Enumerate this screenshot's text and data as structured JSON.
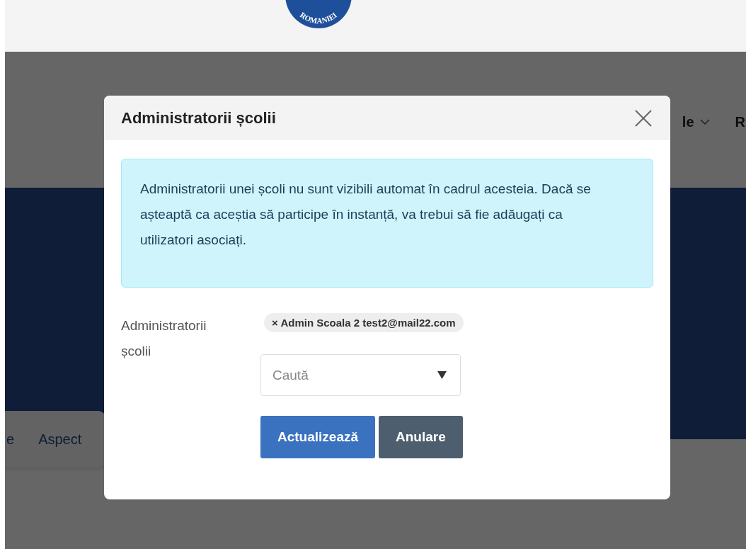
{
  "header": {
    "logo_text": "ROMANIEI"
  },
  "background": {
    "nav_items": [
      {
        "label": "le",
        "has_caret": true
      },
      {
        "label": "R",
        "has_caret": false
      }
    ],
    "tabs": [
      "e",
      "Aspect"
    ]
  },
  "modal": {
    "title": "Administratorii școlii",
    "alert": "Administratorii unei școli nu sunt vizibili automat în cadrul acesteia. Dacă se așteaptă ca aceștia să participe în instanță, va trebui să fie adăugați ca utilizatori asociați.",
    "field": {
      "label": "Administratorii școlii",
      "tags": [
        {
          "remove": "×",
          "label": "Admin Scoala 2 test2@mail22.com"
        }
      ],
      "placeholder": "Caută"
    },
    "buttons": [
      {
        "label": "Actualizează",
        "kind": "primary"
      },
      {
        "label": "Anulare",
        "kind": "secondary"
      }
    ]
  }
}
